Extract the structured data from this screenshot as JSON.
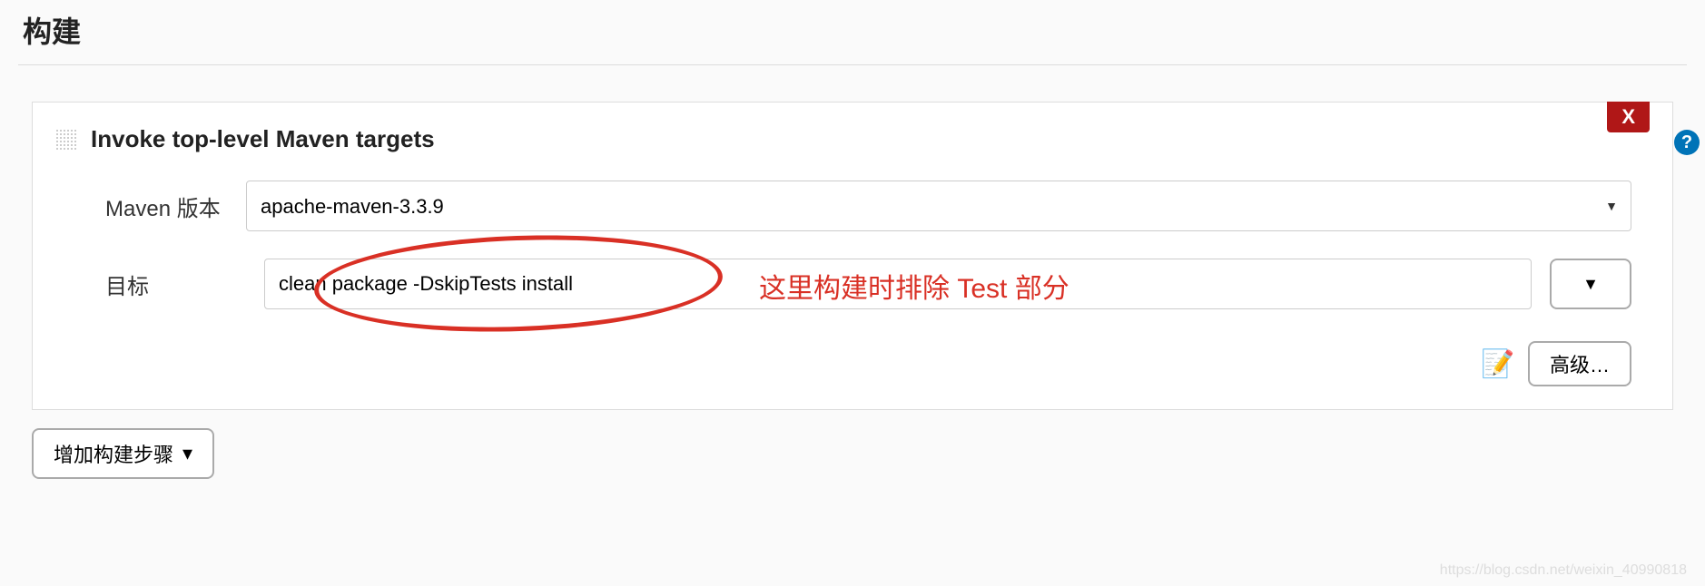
{
  "section": {
    "title": "构建"
  },
  "card": {
    "title": "Invoke top-level Maven targets",
    "close_label": "X",
    "help_label": "?"
  },
  "maven": {
    "label": "Maven 版本",
    "selected": "apache-maven-3.3.9"
  },
  "goals": {
    "label": "目标",
    "value": "clean package -DskipTests install",
    "expand_label": "▼"
  },
  "annotation": {
    "text": "这里构建时排除 Test 部分"
  },
  "advanced": {
    "label": "高级…"
  },
  "add_step": {
    "label": "增加构建步骤",
    "arrow": "▾"
  },
  "watermark": "https://blog.csdn.net/weixin_40990818"
}
